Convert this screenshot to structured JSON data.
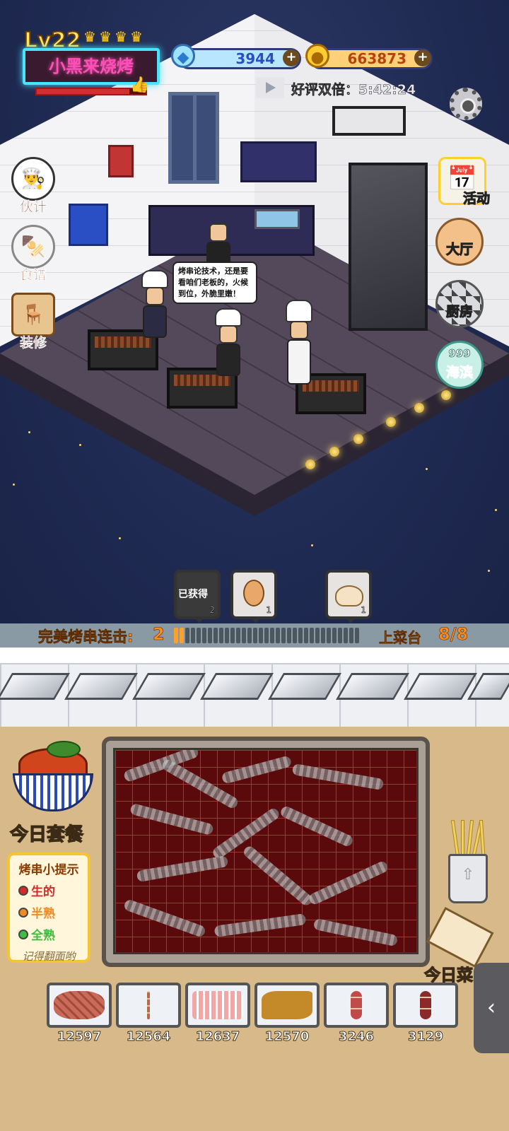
{
  "hud": {
    "level": "Lv22",
    "crowns": 4,
    "shop_name": "小黑来烧烤",
    "xp_progress": 0.85,
    "gems": "3944",
    "coins": "663873",
    "double_reward_text": "好评双倍：5:42:24"
  },
  "left_menu": [
    {
      "label": "伙计",
      "icon": "chef-face-icon"
    },
    {
      "label": "食谱",
      "icon": "recipe-plate-icon"
    },
    {
      "label": "装修",
      "icon": "table-icon"
    }
  ],
  "right_menu": [
    {
      "label": "活动",
      "icon": "calendar-icon"
    },
    {
      "label": "大厅",
      "icon": "hall-icon"
    },
    {
      "label": "厨房",
      "icon": "kitchen-icon"
    },
    {
      "label": "海滨",
      "icon": "seaside-icon",
      "badge": "999"
    }
  ],
  "speech_bubble": "烤串论技术，还是要看咱们老板的，火候到位，外脆里嫩！",
  "order_slots": [
    {
      "label": "已获得",
      "count": "2"
    },
    {
      "item": "egg",
      "count": "1"
    },
    {
      "item": "bun",
      "count": "1"
    }
  ],
  "combo": {
    "label": "完美烤串连击:",
    "value": "2",
    "progress_segments_total": 33,
    "progress_segments_filled": 2
  },
  "serving": {
    "label": "上菜台",
    "value": "8/8"
  },
  "today_set_label": "今日套餐",
  "tips": {
    "title": "烤串小提示",
    "items": [
      {
        "label": "生的",
        "color": "#d42a2a"
      },
      {
        "label": "半熟",
        "color": "#f08a24"
      },
      {
        "label": "全熟",
        "color": "#3fbf3f"
      }
    ],
    "footer": "记得翻面哟"
  },
  "today_menu_label": "今日菜",
  "ingredients": [
    {
      "name": "steak",
      "count": "12597"
    },
    {
      "name": "small-skewer",
      "count": "12564"
    },
    {
      "name": "bacon",
      "count": "12637"
    },
    {
      "name": "fried-noodle",
      "count": "12570"
    },
    {
      "name": "meatball-skewer",
      "count": "3246"
    },
    {
      "name": "sausage-skewer",
      "count": "3129"
    }
  ],
  "colors": {
    "neon_frame": "#48e4ff",
    "shop_name": "#ff4fb6",
    "accent_orange": "#ff8c1a",
    "panel_bg": "#d7b98a"
  }
}
